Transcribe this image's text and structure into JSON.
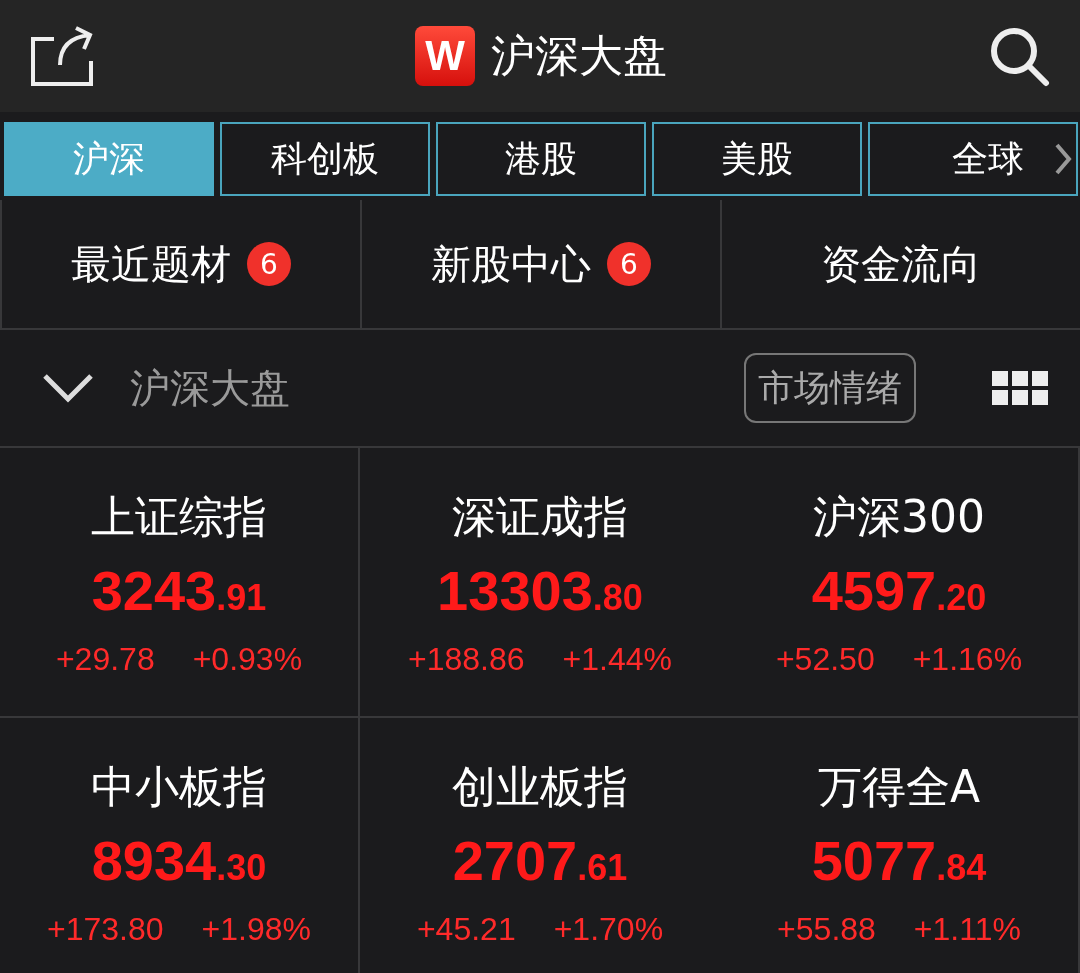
{
  "header": {
    "logo": "W",
    "title": "沪深大盘"
  },
  "tabs": [
    {
      "label": "沪深",
      "selected": true
    },
    {
      "label": "科创板",
      "selected": false
    },
    {
      "label": "港股",
      "selected": false
    },
    {
      "label": "美股",
      "selected": false
    },
    {
      "label": "全球",
      "selected": false
    }
  ],
  "shortcuts": [
    {
      "label": "最近题材",
      "badge": "6"
    },
    {
      "label": "新股中心",
      "badge": "6"
    },
    {
      "label": "资金流向"
    }
  ],
  "section": {
    "title": "沪深大盘",
    "expanded": true,
    "button": "市场情绪"
  },
  "indices": [
    {
      "name": "上证综指",
      "value": "3243",
      "decimals": ".91",
      "change": "+29.78",
      "percent": "+0.93%"
    },
    {
      "name": "深证成指",
      "value": "13303",
      "decimals": ".80",
      "change": "+188.86",
      "percent": "+1.44%"
    },
    {
      "name": "沪深300",
      "value": "4597",
      "decimals": ".20",
      "change": "+52.50",
      "percent": "+1.16%"
    },
    {
      "name": "中小板指",
      "value": "8934",
      "decimals": ".30",
      "change": "+173.80",
      "percent": "+1.98%"
    },
    {
      "name": "创业板指",
      "value": "2707",
      "decimals": ".61",
      "change": "+45.21",
      "percent": "+1.70%"
    },
    {
      "name": "万得全A",
      "value": "5077",
      "decimals": ".84",
      "change": "+55.88",
      "percent": "+1.11%"
    }
  ]
}
